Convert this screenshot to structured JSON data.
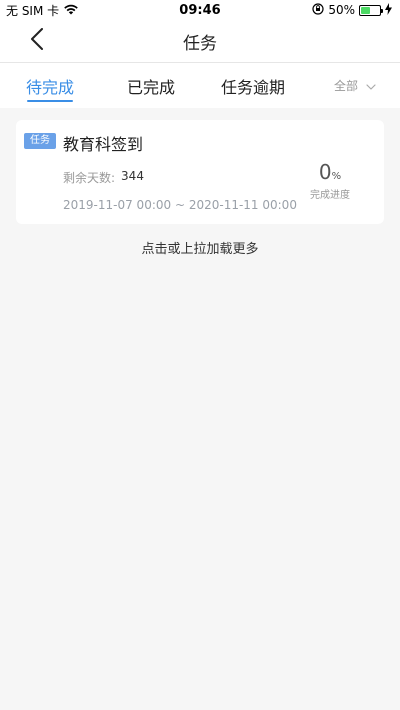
{
  "status_bar": {
    "carrier": "无 SIM 卡",
    "time": "09:46",
    "battery_percent_label": "50%",
    "battery_level": 0.5
  },
  "nav": {
    "title": "任务"
  },
  "tabs": [
    {
      "label": "待完成",
      "active": true
    },
    {
      "label": "已完成",
      "active": false
    },
    {
      "label": "任务逾期",
      "active": false
    }
  ],
  "filter": {
    "label": "全部"
  },
  "task_card": {
    "badge": "任务",
    "title": "教育科签到",
    "remain_label": "剩余天数:",
    "remain_value": "344",
    "date_range": "2019-11-07 00:00 ~ 2020-11-11 00:00",
    "progress_value": "0",
    "progress_unit": "%",
    "progress_label": "完成进度"
  },
  "load_more": "点击或上拉加载更多",
  "colors": {
    "accent": "#3a8ee6",
    "badge": "#6aa1e8",
    "battery": "#4cd964"
  }
}
